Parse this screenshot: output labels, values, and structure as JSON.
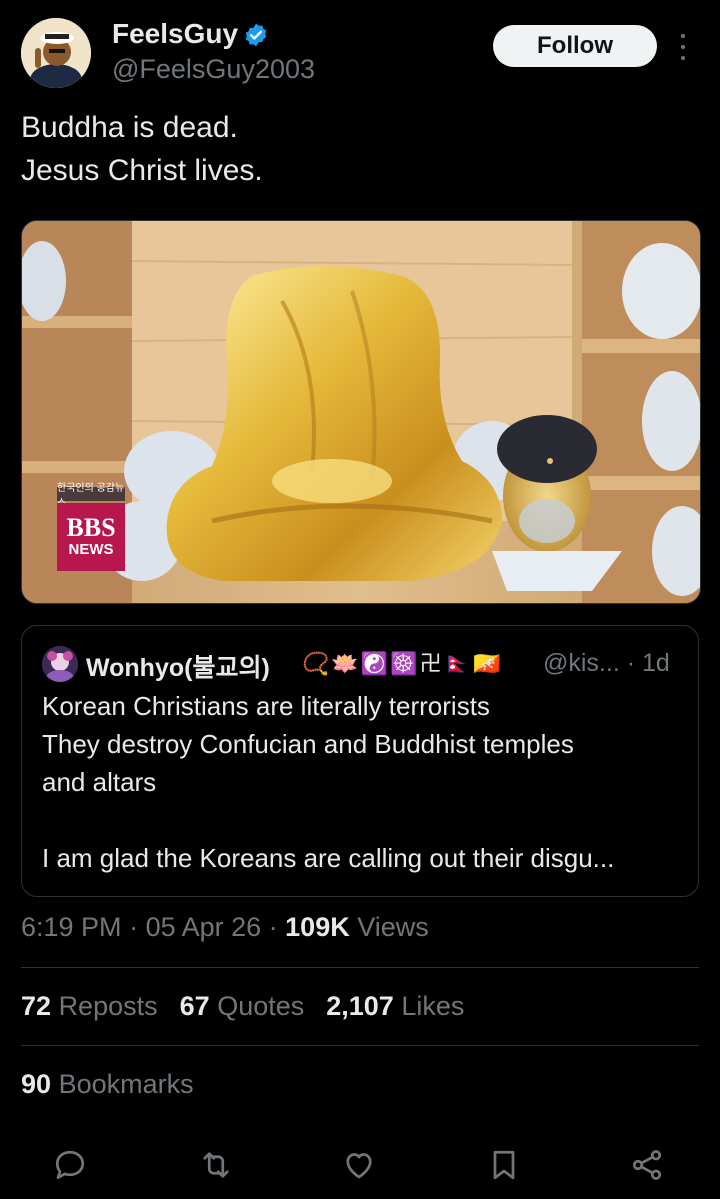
{
  "author": {
    "display_name": "FeelsGuy",
    "handle": "@FeelsGuy2003",
    "verified": true,
    "follow_label": "Follow"
  },
  "tweet": {
    "lines": [
      "Buddha is dead.",
      "Jesus Christ lives."
    ]
  },
  "media": {
    "description": "Headless golden Buddha statue and a separated golden Buddha head on wooden shelves",
    "watermark_small": "한국인의 공감뉴스",
    "watermark_big": "BBS",
    "watermark_sub": "NEWS"
  },
  "quoted_tweet": {
    "display_name": "Wonhyo(불교의)",
    "emojis": [
      "📿",
      "🪷",
      "☯️",
      "☸️",
      "卍",
      "🇳🇵",
      "🇧🇹"
    ],
    "handle": "@kis...",
    "time": "· 1d",
    "lines": [
      "Korean Christians are literally terrorists",
      "They destroy Confucian and Buddhist temples",
      "and altars",
      "",
      "I am glad the Koreans are calling out their disgu..."
    ]
  },
  "meta": {
    "time": "6:19 PM",
    "date": "05 Apr 26",
    "views_count": "109K",
    "views_label": "Views"
  },
  "stats": {
    "reposts_count": "72",
    "reposts_label": "Reposts",
    "quotes_count": "67",
    "quotes_label": "Quotes",
    "likes_count": "2,107",
    "likes_label": "Likes",
    "bookmarks_count": "90",
    "bookmarks_label": "Bookmarks"
  },
  "actions": [
    "reply-icon",
    "repost-icon",
    "like-icon",
    "bookmark-icon",
    "share-icon"
  ],
  "colors": {
    "background": "#000000",
    "text": "#e7e9ea",
    "secondary": "#71767b",
    "border": "#2f3336",
    "verified": "#1d9bf0",
    "follow_bg": "#eff3f4"
  }
}
